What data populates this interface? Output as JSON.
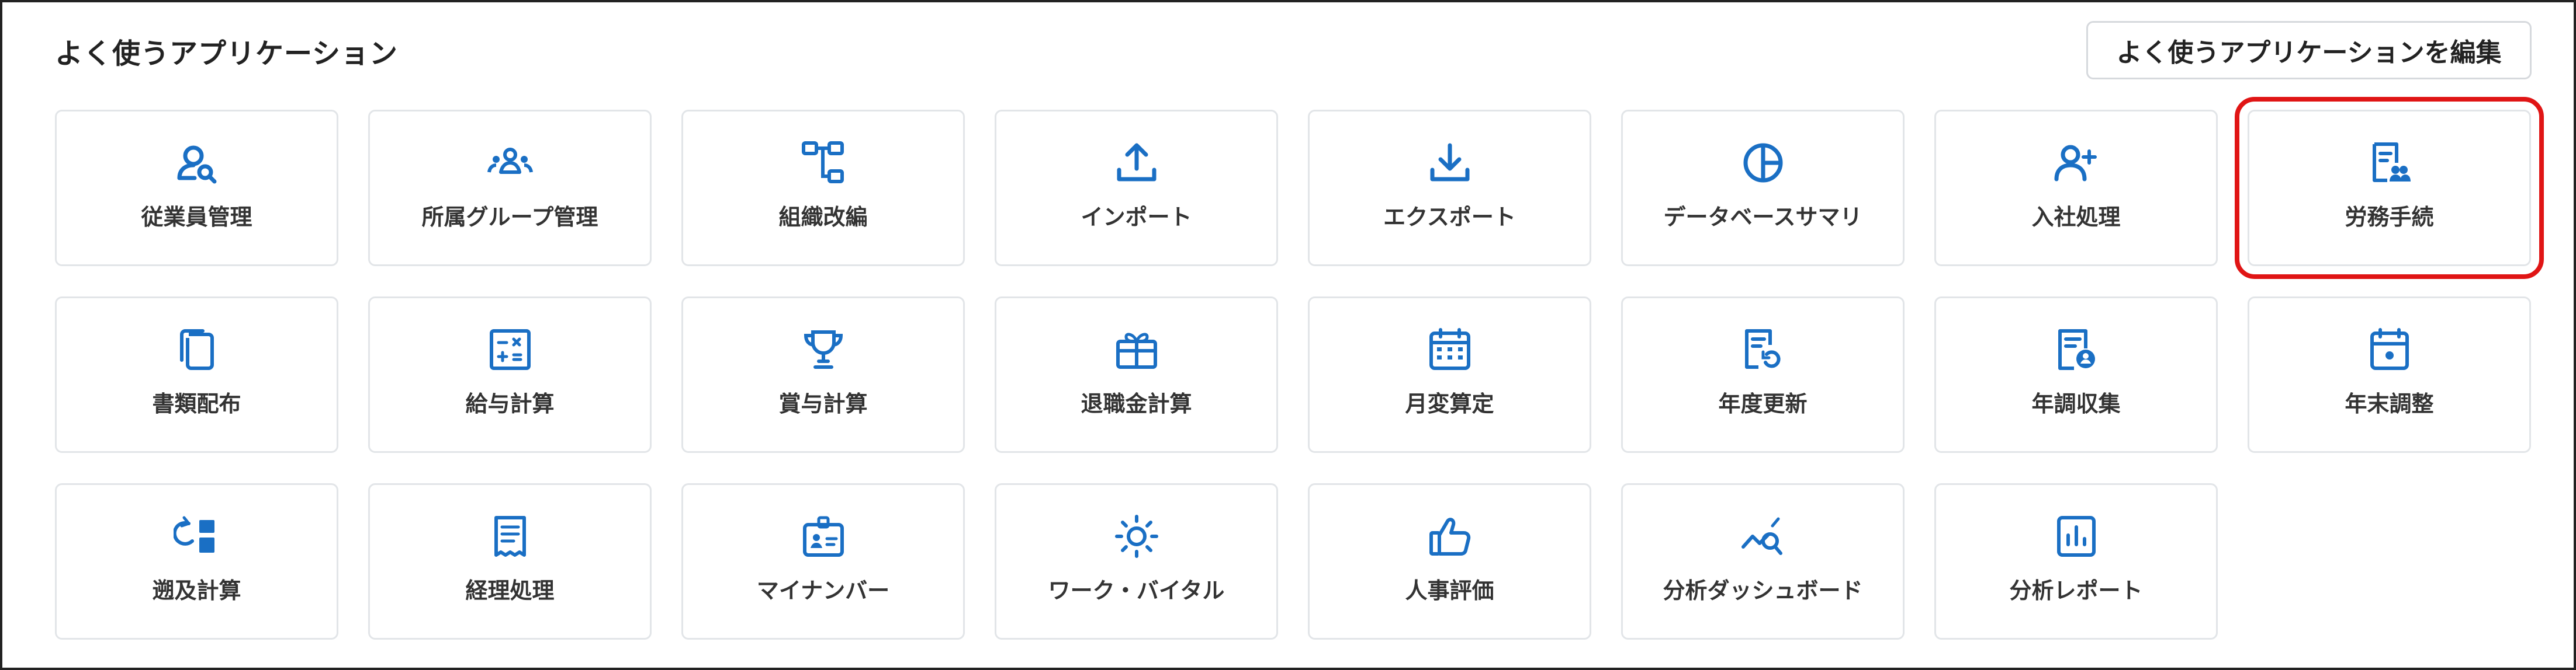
{
  "header": {
    "title": "よく使うアプリケーション",
    "edit_button_label": "よく使うアプリケーションを編集"
  },
  "colors": {
    "accent": "#1a6fc4",
    "highlight_border": "#e01515"
  },
  "apps": [
    {
      "label": "従業員管理",
      "icon": "person-search-icon"
    },
    {
      "label": "所属グループ管理",
      "icon": "group-icon"
    },
    {
      "label": "組織改編",
      "icon": "org-tree-icon"
    },
    {
      "label": "インポート",
      "icon": "upload-icon"
    },
    {
      "label": "エクスポート",
      "icon": "download-icon"
    },
    {
      "label": "データベースサマリ",
      "icon": "pie-chart-icon"
    },
    {
      "label": "入社処理",
      "icon": "add-person-icon"
    },
    {
      "label": "労務手続",
      "icon": "document-person-icon",
      "highlighted": true
    },
    {
      "label": "書類配布",
      "icon": "copy-documents-icon"
    },
    {
      "label": "給与計算",
      "icon": "calculator-icon"
    },
    {
      "label": "賞与計算",
      "icon": "trophy-icon"
    },
    {
      "label": "退職金計算",
      "icon": "gift-box-icon"
    },
    {
      "label": "月変算定",
      "icon": "calendar-grid-icon"
    },
    {
      "label": "年度更新",
      "icon": "document-refresh-icon"
    },
    {
      "label": "年調収集",
      "icon": "document-user-icon"
    },
    {
      "label": "年末調整",
      "icon": "calendar-dot-icon"
    },
    {
      "label": "遡及計算",
      "icon": "retro-calc-icon"
    },
    {
      "label": "経理処理",
      "icon": "receipt-icon"
    },
    {
      "label": "マイナンバー",
      "icon": "id-card-icon"
    },
    {
      "label": "ワーク・バイタル",
      "icon": "sun-icon"
    },
    {
      "label": "人事評価",
      "icon": "thumbs-up-icon"
    },
    {
      "label": "分析ダッシュボード",
      "icon": "analytics-search-icon"
    },
    {
      "label": "分析レポート",
      "icon": "bar-report-icon"
    }
  ]
}
